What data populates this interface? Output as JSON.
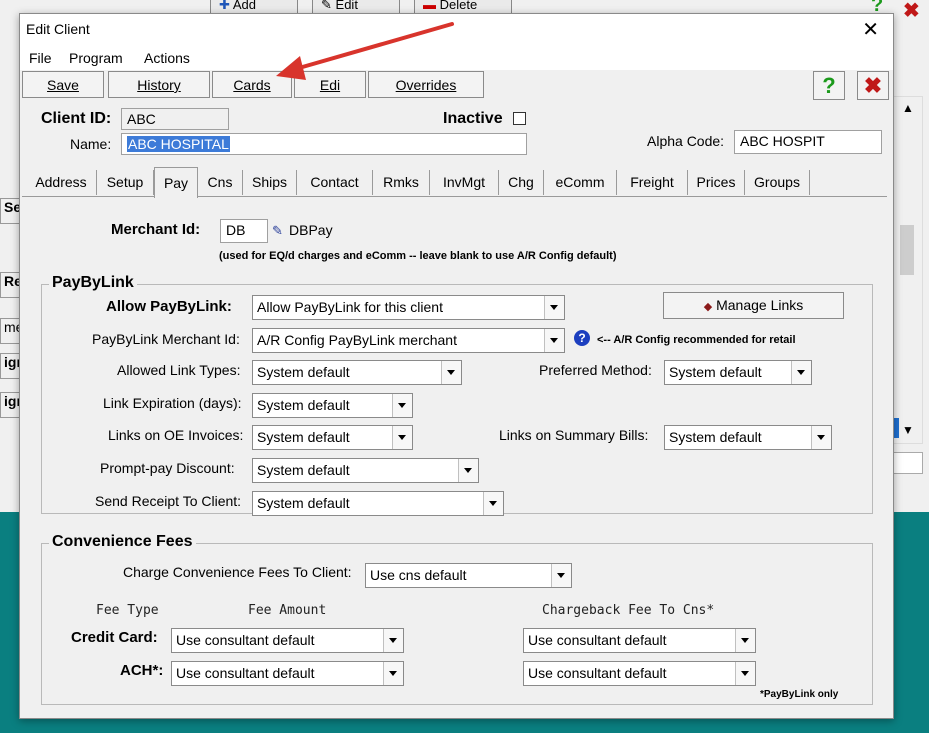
{
  "background": {
    "toolbar": [
      "Add",
      "Edit",
      "Delete"
    ],
    "left_fragments": [
      "Se",
      "Re",
      "me",
      "ign",
      "ign"
    ]
  },
  "window": {
    "title": "Edit Client",
    "close_glyph": "✕"
  },
  "menu": [
    "File",
    "Program",
    "Actions"
  ],
  "toolbar": {
    "save": "Save",
    "history": "History",
    "cards": "Cards",
    "edi": "Edi",
    "overrides": "Overrides",
    "help_glyph": "?",
    "close_glyph": "✖"
  },
  "header": {
    "client_id_label": "Client ID:",
    "client_id": "ABC",
    "name_label": "Name:",
    "name": "ABC HOSPITAL",
    "inactive_label": "Inactive",
    "alpha_code_label": "Alpha Code:",
    "alpha_code": "ABC HOSPIT"
  },
  "tabs": [
    "Address",
    "Setup",
    "Pay",
    "Cns",
    "Ships",
    "Contact",
    "Rmks",
    "InvMgt",
    "Chg",
    "eComm",
    "Freight",
    "Prices",
    "Groups"
  ],
  "active_tab": "Pay",
  "pay": {
    "merchant_id_label": "Merchant Id:",
    "merchant_id": "DB",
    "merchant_name": "DBPay",
    "merchant_note": "(used for EQ/d charges and eComm -- leave blank to use A/R Config default)",
    "paybylink": {
      "title": "PayByLink",
      "allow_label": "Allow PayByLink:",
      "allow_value": "Allow PayByLink for this client",
      "manage_links": "Manage Links",
      "merchant_label": "PayByLink Merchant Id:",
      "merchant_value": "A/R Config PayByLink merchant",
      "merchant_hint": "<-- A/R Config recommended for retail",
      "allowed_types_label": "Allowed Link Types:",
      "allowed_types_value": "System default",
      "preferred_method_label": "Preferred Method:",
      "preferred_method_value": "System default",
      "expiration_label": "Link Expiration (days):",
      "expiration_value": "System default",
      "oe_invoices_label": "Links on OE Invoices:",
      "oe_invoices_value": "System default",
      "summary_bills_label": "Links on Summary Bills:",
      "summary_bills_value": "System default",
      "discount_label": "Prompt-pay Discount:",
      "discount_value": "System default",
      "receipt_label": "Send Receipt To Client:",
      "receipt_value": "System default"
    },
    "convenience": {
      "title": "Convenience Fees",
      "charge_label": "Charge Convenience Fees To Client:",
      "charge_value": "Use cns default",
      "col_fee_type": "Fee Type",
      "col_fee_amount": "Fee Amount",
      "col_chargeback": "Chargeback Fee To Cns*",
      "credit_label": "Credit Card:",
      "credit_amount": "Use consultant default",
      "credit_chargeback": "Use consultant default",
      "ach_label": "ACH*:",
      "ach_amount": "Use consultant default",
      "ach_chargeback": "Use consultant default",
      "footnote": "*PayByLink only"
    }
  },
  "colors": {
    "accent_red": "#d8342c",
    "help_green": "#1c9a1c",
    "teal_desktop": "#0a7f80",
    "selection_blue": "#3d7bd8"
  }
}
